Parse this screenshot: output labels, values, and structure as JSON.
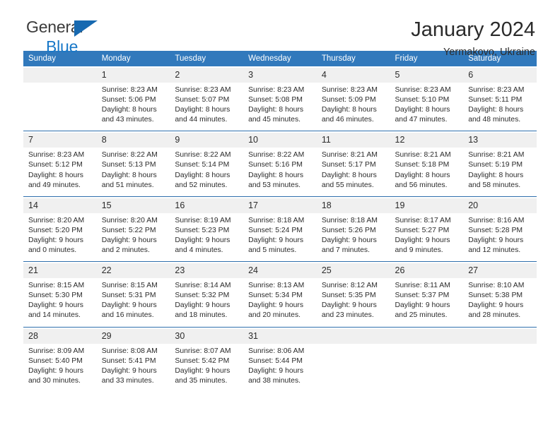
{
  "brand": {
    "name_part1": "General",
    "name_part2": "Blue",
    "logo_icon": "triangle-logo-icon",
    "color_primary": "#1769b0",
    "color_secondary": "#1878c8"
  },
  "header": {
    "title": "January 2024",
    "subtitle": "Yermakovo, Ukraine"
  },
  "calendar": {
    "accent_color": "#3179bc",
    "daynum_band_color": "#f0f0f0",
    "weekday_headers": [
      "Sunday",
      "Monday",
      "Tuesday",
      "Wednesday",
      "Thursday",
      "Friday",
      "Saturday"
    ],
    "weeks": [
      [
        {
          "day": "",
          "sunrise": "",
          "sunset": "",
          "daylight_line1": "",
          "daylight_line2": ""
        },
        {
          "day": "1",
          "sunrise": "Sunrise: 8:23 AM",
          "sunset": "Sunset: 5:06 PM",
          "daylight_line1": "Daylight: 8 hours",
          "daylight_line2": "and 43 minutes."
        },
        {
          "day": "2",
          "sunrise": "Sunrise: 8:23 AM",
          "sunset": "Sunset: 5:07 PM",
          "daylight_line1": "Daylight: 8 hours",
          "daylight_line2": "and 44 minutes."
        },
        {
          "day": "3",
          "sunrise": "Sunrise: 8:23 AM",
          "sunset": "Sunset: 5:08 PM",
          "daylight_line1": "Daylight: 8 hours",
          "daylight_line2": "and 45 minutes."
        },
        {
          "day": "4",
          "sunrise": "Sunrise: 8:23 AM",
          "sunset": "Sunset: 5:09 PM",
          "daylight_line1": "Daylight: 8 hours",
          "daylight_line2": "and 46 minutes."
        },
        {
          "day": "5",
          "sunrise": "Sunrise: 8:23 AM",
          "sunset": "Sunset: 5:10 PM",
          "daylight_line1": "Daylight: 8 hours",
          "daylight_line2": "and 47 minutes."
        },
        {
          "day": "6",
          "sunrise": "Sunrise: 8:23 AM",
          "sunset": "Sunset: 5:11 PM",
          "daylight_line1": "Daylight: 8 hours",
          "daylight_line2": "and 48 minutes."
        }
      ],
      [
        {
          "day": "7",
          "sunrise": "Sunrise: 8:23 AM",
          "sunset": "Sunset: 5:12 PM",
          "daylight_line1": "Daylight: 8 hours",
          "daylight_line2": "and 49 minutes."
        },
        {
          "day": "8",
          "sunrise": "Sunrise: 8:22 AM",
          "sunset": "Sunset: 5:13 PM",
          "daylight_line1": "Daylight: 8 hours",
          "daylight_line2": "and 51 minutes."
        },
        {
          "day": "9",
          "sunrise": "Sunrise: 8:22 AM",
          "sunset": "Sunset: 5:14 PM",
          "daylight_line1": "Daylight: 8 hours",
          "daylight_line2": "and 52 minutes."
        },
        {
          "day": "10",
          "sunrise": "Sunrise: 8:22 AM",
          "sunset": "Sunset: 5:16 PM",
          "daylight_line1": "Daylight: 8 hours",
          "daylight_line2": "and 53 minutes."
        },
        {
          "day": "11",
          "sunrise": "Sunrise: 8:21 AM",
          "sunset": "Sunset: 5:17 PM",
          "daylight_line1": "Daylight: 8 hours",
          "daylight_line2": "and 55 minutes."
        },
        {
          "day": "12",
          "sunrise": "Sunrise: 8:21 AM",
          "sunset": "Sunset: 5:18 PM",
          "daylight_line1": "Daylight: 8 hours",
          "daylight_line2": "and 56 minutes."
        },
        {
          "day": "13",
          "sunrise": "Sunrise: 8:21 AM",
          "sunset": "Sunset: 5:19 PM",
          "daylight_line1": "Daylight: 8 hours",
          "daylight_line2": "and 58 minutes."
        }
      ],
      [
        {
          "day": "14",
          "sunrise": "Sunrise: 8:20 AM",
          "sunset": "Sunset: 5:20 PM",
          "daylight_line1": "Daylight: 9 hours",
          "daylight_line2": "and 0 minutes."
        },
        {
          "day": "15",
          "sunrise": "Sunrise: 8:20 AM",
          "sunset": "Sunset: 5:22 PM",
          "daylight_line1": "Daylight: 9 hours",
          "daylight_line2": "and 2 minutes."
        },
        {
          "day": "16",
          "sunrise": "Sunrise: 8:19 AM",
          "sunset": "Sunset: 5:23 PM",
          "daylight_line1": "Daylight: 9 hours",
          "daylight_line2": "and 4 minutes."
        },
        {
          "day": "17",
          "sunrise": "Sunrise: 8:18 AM",
          "sunset": "Sunset: 5:24 PM",
          "daylight_line1": "Daylight: 9 hours",
          "daylight_line2": "and 5 minutes."
        },
        {
          "day": "18",
          "sunrise": "Sunrise: 8:18 AM",
          "sunset": "Sunset: 5:26 PM",
          "daylight_line1": "Daylight: 9 hours",
          "daylight_line2": "and 7 minutes."
        },
        {
          "day": "19",
          "sunrise": "Sunrise: 8:17 AM",
          "sunset": "Sunset: 5:27 PM",
          "daylight_line1": "Daylight: 9 hours",
          "daylight_line2": "and 9 minutes."
        },
        {
          "day": "20",
          "sunrise": "Sunrise: 8:16 AM",
          "sunset": "Sunset: 5:28 PM",
          "daylight_line1": "Daylight: 9 hours",
          "daylight_line2": "and 12 minutes."
        }
      ],
      [
        {
          "day": "21",
          "sunrise": "Sunrise: 8:15 AM",
          "sunset": "Sunset: 5:30 PM",
          "daylight_line1": "Daylight: 9 hours",
          "daylight_line2": "and 14 minutes."
        },
        {
          "day": "22",
          "sunrise": "Sunrise: 8:15 AM",
          "sunset": "Sunset: 5:31 PM",
          "daylight_line1": "Daylight: 9 hours",
          "daylight_line2": "and 16 minutes."
        },
        {
          "day": "23",
          "sunrise": "Sunrise: 8:14 AM",
          "sunset": "Sunset: 5:32 PM",
          "daylight_line1": "Daylight: 9 hours",
          "daylight_line2": "and 18 minutes."
        },
        {
          "day": "24",
          "sunrise": "Sunrise: 8:13 AM",
          "sunset": "Sunset: 5:34 PM",
          "daylight_line1": "Daylight: 9 hours",
          "daylight_line2": "and 20 minutes."
        },
        {
          "day": "25",
          "sunrise": "Sunrise: 8:12 AM",
          "sunset": "Sunset: 5:35 PM",
          "daylight_line1": "Daylight: 9 hours",
          "daylight_line2": "and 23 minutes."
        },
        {
          "day": "26",
          "sunrise": "Sunrise: 8:11 AM",
          "sunset": "Sunset: 5:37 PM",
          "daylight_line1": "Daylight: 9 hours",
          "daylight_line2": "and 25 minutes."
        },
        {
          "day": "27",
          "sunrise": "Sunrise: 8:10 AM",
          "sunset": "Sunset: 5:38 PM",
          "daylight_line1": "Daylight: 9 hours",
          "daylight_line2": "and 28 minutes."
        }
      ],
      [
        {
          "day": "28",
          "sunrise": "Sunrise: 8:09 AM",
          "sunset": "Sunset: 5:40 PM",
          "daylight_line1": "Daylight: 9 hours",
          "daylight_line2": "and 30 minutes."
        },
        {
          "day": "29",
          "sunrise": "Sunrise: 8:08 AM",
          "sunset": "Sunset: 5:41 PM",
          "daylight_line1": "Daylight: 9 hours",
          "daylight_line2": "and 33 minutes."
        },
        {
          "day": "30",
          "sunrise": "Sunrise: 8:07 AM",
          "sunset": "Sunset: 5:42 PM",
          "daylight_line1": "Daylight: 9 hours",
          "daylight_line2": "and 35 minutes."
        },
        {
          "day": "31",
          "sunrise": "Sunrise: 8:06 AM",
          "sunset": "Sunset: 5:44 PM",
          "daylight_line1": "Daylight: 9 hours",
          "daylight_line2": "and 38 minutes."
        },
        {
          "day": "",
          "sunrise": "",
          "sunset": "",
          "daylight_line1": "",
          "daylight_line2": ""
        },
        {
          "day": "",
          "sunrise": "",
          "sunset": "",
          "daylight_line1": "",
          "daylight_line2": ""
        },
        {
          "day": "",
          "sunrise": "",
          "sunset": "",
          "daylight_line1": "",
          "daylight_line2": ""
        }
      ]
    ]
  }
}
